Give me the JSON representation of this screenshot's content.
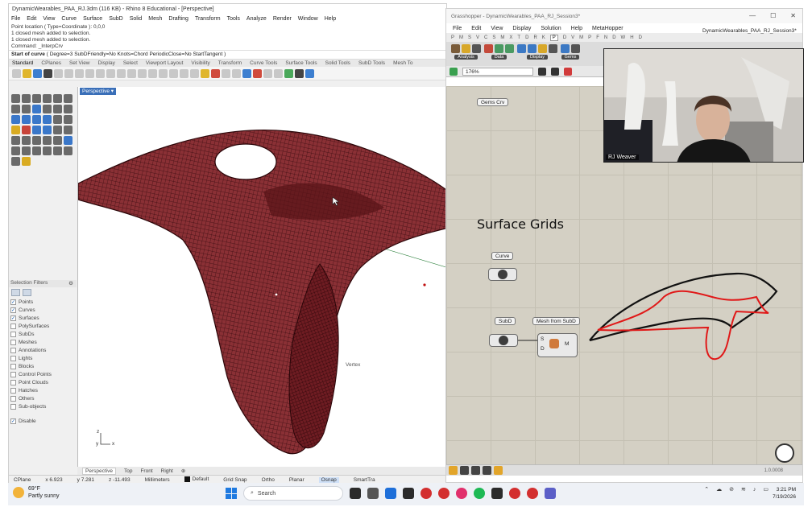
{
  "rhino": {
    "title": "DynamicWearables_PAA_RJ.3dm (116 KB) - Rhino 8 Educational - [Perspective]",
    "menu": [
      "File",
      "Edit",
      "View",
      "Curve",
      "Surface",
      "SubD",
      "Solid",
      "Mesh",
      "Drafting",
      "Transform",
      "Tools",
      "Analyze",
      "Render",
      "Window",
      "Help"
    ],
    "command_history": [
      "Point location ( Type=Coordinate ): 0,0,0",
      "1 closed mesh added to selection.",
      "1 closed mesh added to selection.",
      "Command: _InterpCrv"
    ],
    "prompt_bold": "Start of curve",
    "prompt_rest": "( Degree=3  SubDFriendly=No  Knots=Chord  PeriodicClose=No  StartTangent )",
    "toolbar_tabs": [
      "Standard",
      "CPlanes",
      "Set View",
      "Display",
      "Select",
      "Viewport Layout",
      "Visibility",
      "Transform",
      "Curve Tools",
      "Surface Tools",
      "Solid Tools",
      "SubD Tools",
      "Mesh To"
    ],
    "viewport_label": "Perspective ▾",
    "vertex_label": "Vertex",
    "axis": {
      "z": "z",
      "y": "y",
      "x": "x"
    },
    "viewport_tabs": [
      "Perspective",
      "Top",
      "Front",
      "Right",
      "⊕"
    ],
    "selection_filters": {
      "title": "Selection Filters",
      "items": [
        {
          "label": "Points",
          "checked": true
        },
        {
          "label": "Curves",
          "checked": true
        },
        {
          "label": "Surfaces",
          "checked": true
        },
        {
          "label": "PolySurfaces",
          "checked": false
        },
        {
          "label": "SubDs",
          "checked": false
        },
        {
          "label": "Meshes",
          "checked": false
        },
        {
          "label": "Annotations",
          "checked": false
        },
        {
          "label": "Lights",
          "checked": false
        },
        {
          "label": "Blocks",
          "checked": false
        },
        {
          "label": "Control Points",
          "checked": false
        },
        {
          "label": "Point Clouds",
          "checked": false
        },
        {
          "label": "Hatches",
          "checked": false
        },
        {
          "label": "Others",
          "checked": false
        },
        {
          "label": "Sub-objects",
          "checked": false
        }
      ],
      "disable_label": "Disable"
    },
    "status": {
      "cplane": "CPlane",
      "x": "x 6.923",
      "y": "y 7.281",
      "z": "z -11.493",
      "units": "Millimeters",
      "layer": "Default",
      "grid_snap": "Grid Snap",
      "ortho": "Ortho",
      "planar": "Planar",
      "osnap": "Osnap",
      "smarttrack": "SmartTra"
    },
    "mesh_color": "#7a1f24"
  },
  "grasshopper": {
    "title": "Grasshopper - DynamicWearables_PAA_RJ_Session3*",
    "document": "DynamicWearables_PAA_RJ_Session3*",
    "menu": [
      "File",
      "Edit",
      "View",
      "Display",
      "Solution",
      "Help",
      "MetaHopper"
    ],
    "categories": [
      "P",
      "M",
      "S",
      "V",
      "C",
      "S",
      "M",
      "X",
      "T",
      "D",
      "R",
      "K",
      "P",
      "D",
      "V",
      "M",
      "P",
      "F",
      "N",
      "D",
      "W",
      "H",
      "D"
    ],
    "active_category_index": 12,
    "ribbon_groups": [
      "Analysis",
      "Data",
      "Display",
      "Gems"
    ],
    "zoom": "176%",
    "canvas": {
      "heading": "Surface Grids",
      "gems_tag": "Gems Crv",
      "curve_tag": "Curve",
      "subd_tag": "SubD",
      "mesh_tag": "Mesh from SubD",
      "port_s": "S",
      "port_d": "D",
      "port_m": "M"
    },
    "version": "1.0.0008",
    "sketch_colors": {
      "outline": "#111111",
      "highlight": "#e01818"
    }
  },
  "webcam": {
    "name": "RJ Weaver"
  },
  "taskbar": {
    "temperature": "69°F",
    "weather": "Partly sunny",
    "search": "Search",
    "time": "3:21 PM",
    "date": "7/19/2026"
  }
}
